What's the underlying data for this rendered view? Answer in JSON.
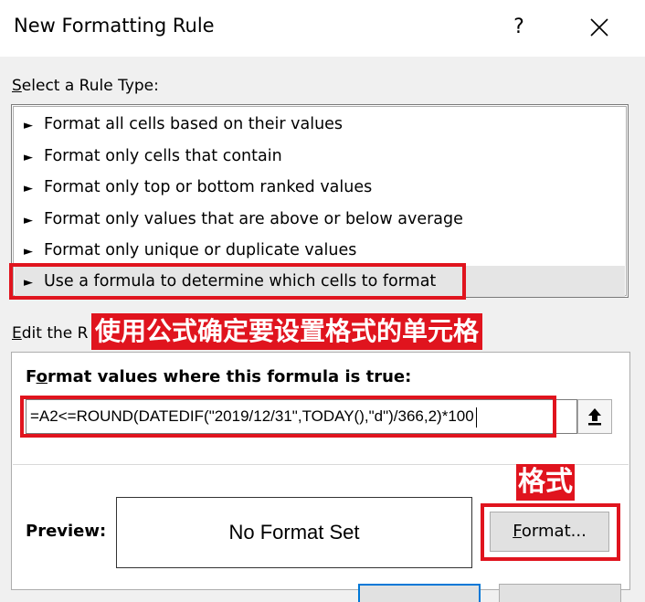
{
  "dialog": {
    "title": "New Formatting Rule",
    "help_glyph": "?"
  },
  "rule_type": {
    "label_mnemonic": "S",
    "label_rest": "elect a Rule Type:",
    "items": [
      {
        "bullet": "►",
        "label": "Format all cells based on their values"
      },
      {
        "bullet": "►",
        "label": "Format only cells that contain"
      },
      {
        "bullet": "►",
        "label": "Format only top or bottom ranked values"
      },
      {
        "bullet": "►",
        "label": "Format only values that are above or below average"
      },
      {
        "bullet": "►",
        "label": "Format only unique or duplicate values"
      },
      {
        "bullet": "►",
        "label": "Use a formula to determine which cells to format"
      }
    ],
    "selected_index": 5
  },
  "edit_rule": {
    "label_mnemonic": "E",
    "label_rest": "dit the R",
    "formula_label_pre": "F",
    "formula_label_mnemonic": "o",
    "formula_label_rest": "rmat values where this formula is true:",
    "formula_value": "=A2<=ROUND(DATEDIF(\"2019/12/31\",TODAY(),\"d\")/366,2)*100",
    "preview_label": "Preview:",
    "preview_text": "No Format Set",
    "format_button_mnemonic": "F",
    "format_button_rest": "ormat..."
  },
  "annotations": {
    "rule_banner": "使用公式确定要设置格式的单元格",
    "format_banner": "格式",
    "highlight_color": "#e0141e"
  },
  "icons": {
    "close": "close-icon",
    "collapse": "collapse-dialog-icon"
  }
}
